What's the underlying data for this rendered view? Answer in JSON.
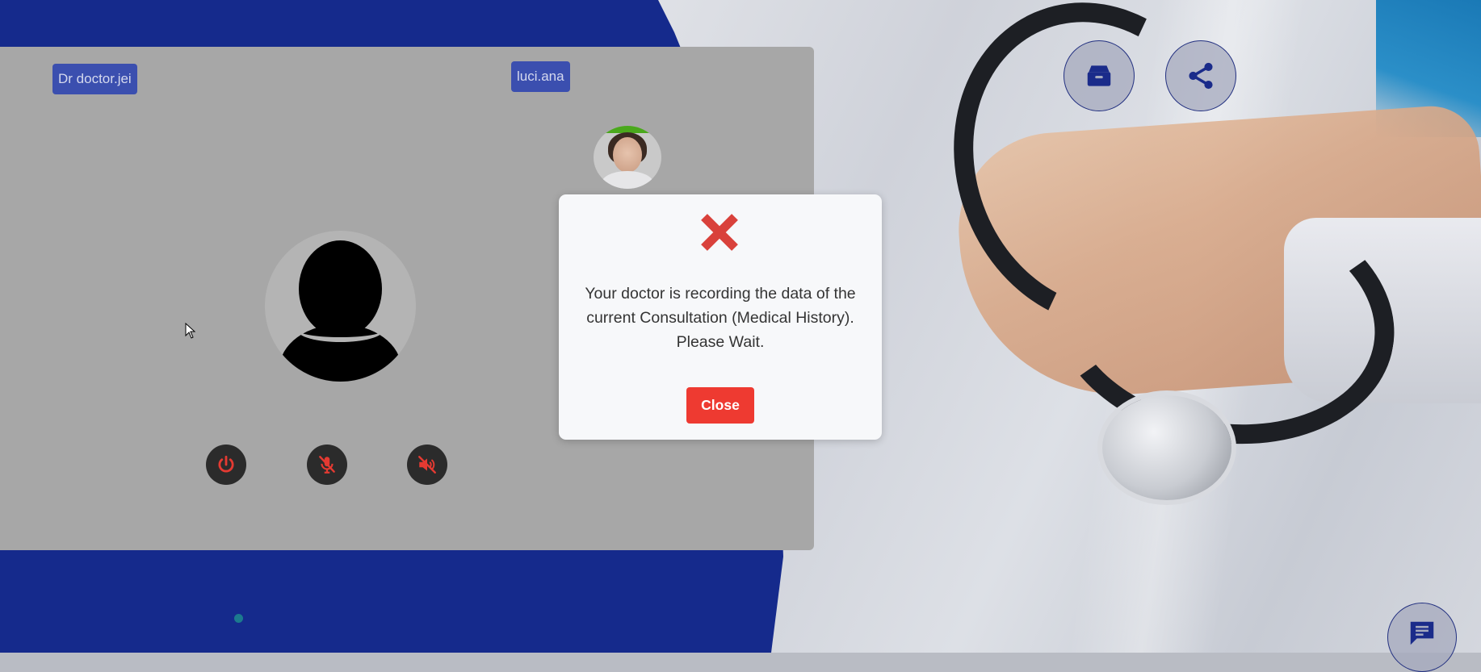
{
  "participants": {
    "doctor_name": "Dr doctor.jei",
    "patient_name": "luci.ana"
  },
  "controls": {
    "power_icon": "power-icon",
    "mic_icon": "mic-off-icon",
    "speaker_icon": "speaker-off-icon"
  },
  "floating_buttons": {
    "archive_icon": "archive-box-icon",
    "share_icon": "share-icon",
    "chat_icon": "chat-icon"
  },
  "modal": {
    "icon": "error-x-icon",
    "message_line1": "Your doctor is recording the data of the",
    "message_line2": "current Consultation (Medical History).",
    "message_line3": "Please Wait.",
    "close_label": "Close"
  },
  "colors": {
    "brand_blue": "#152a8c",
    "badge_blue": "#3b4faf",
    "danger_red": "#ee3a31",
    "status_green": "#4aa81c"
  }
}
